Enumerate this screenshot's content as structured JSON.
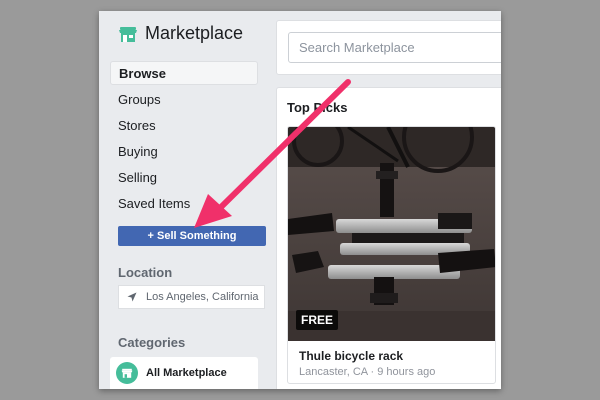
{
  "brand": {
    "title": "Marketplace",
    "icon": "storefront-icon",
    "icon_color": "#45bd9a"
  },
  "sidebar": {
    "items": [
      {
        "label": "Browse",
        "active": true
      },
      {
        "label": "Groups",
        "active": false
      },
      {
        "label": "Stores",
        "active": false
      },
      {
        "label": "Buying",
        "active": false
      },
      {
        "label": "Selling",
        "active": false
      },
      {
        "label": "Saved Items",
        "active": false
      }
    ],
    "sell_button": "+ Sell Something",
    "location_title": "Location",
    "location_value": "Los Angeles, California",
    "categories_title": "Categories",
    "categories": [
      {
        "label": "All Marketplace",
        "icon": "storefront-icon"
      }
    ]
  },
  "search": {
    "placeholder": "Search Marketplace",
    "value": ""
  },
  "top_picks": {
    "title": "Top Picks",
    "listing": {
      "badge": "FREE",
      "title": "Thule bicycle rack",
      "meta": "Lancaster, CA · 9 hours ago"
    }
  },
  "colors": {
    "page_bg": "#9a9a9a",
    "window_bg": "#e9ebee",
    "primary_button": "#4267b2",
    "annotation_arrow": "#f0306a"
  }
}
